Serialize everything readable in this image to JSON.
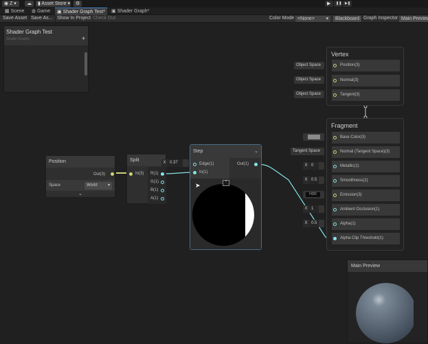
{
  "toolbar": {
    "account": "Z",
    "asset_store": "Asset Store",
    "play": "▶",
    "pause": "❚❚",
    "step": "▶❚"
  },
  "tabs": [
    {
      "label": "Scene"
    },
    {
      "label": "Game"
    },
    {
      "label": "Shader Graph Test*"
    },
    {
      "label": "Shader Graph*"
    }
  ],
  "graph_toolbar": {
    "save_asset": "Save Asset",
    "save_as": "Save As...",
    "show_in_project": "Show In Project",
    "check_out": "Check Out",
    "color_mode_label": "Color Mode",
    "color_mode_value": "<None>",
    "blackboard": "Blackboard",
    "graph_inspector": "Graph Inspector",
    "main_preview": "Main Preview"
  },
  "blackboard": {
    "title": "Shader Graph Test",
    "subtitle": "Shader Graphs",
    "add": "+"
  },
  "position_node": {
    "title": "Position",
    "out": "Out(3)",
    "space_label": "Space",
    "space_value": "World"
  },
  "split_node": {
    "title": "Split",
    "in": "In(3)",
    "outputs": [
      "R(1)",
      "G(1)",
      "B(1)",
      "A(1)"
    ]
  },
  "step_node": {
    "title": "Step",
    "edge": "Edge(1)",
    "in": "In(1)",
    "out": "Out(1)",
    "edge_x": "X",
    "edge_value": "0.37"
  },
  "vertex": {
    "title": "Vertex",
    "rows": [
      {
        "label": "Position(3)",
        "input": "Object Space"
      },
      {
        "label": "Normal(3)",
        "input": "Object Space"
      },
      {
        "label": "Tangent(3)",
        "input": "Object Space"
      }
    ]
  },
  "fragment": {
    "title": "Fragment",
    "rows": [
      {
        "label": "Base Color(3)",
        "input": ""
      },
      {
        "label": "Normal (Tangent Space)(3)",
        "input": "Tangent Space"
      },
      {
        "label": "Metallic(1)",
        "input": "0"
      },
      {
        "label": "Smoothness(1)",
        "input": "0.5"
      },
      {
        "label": "Emission(3)",
        "input": "HDR"
      },
      {
        "label": "Ambient Occlusion(1)",
        "input": "1"
      },
      {
        "label": "Alpha(1)",
        "input": "0.5"
      },
      {
        "label": "Alpha Clip Threshold(1)",
        "input": ""
      }
    ],
    "x": "X"
  },
  "main_preview": {
    "title": "Main Preview"
  },
  "colors": {
    "cyan": "#84e4e7",
    "yellow": "#cfd27a",
    "accent": "#4a8bd0"
  }
}
